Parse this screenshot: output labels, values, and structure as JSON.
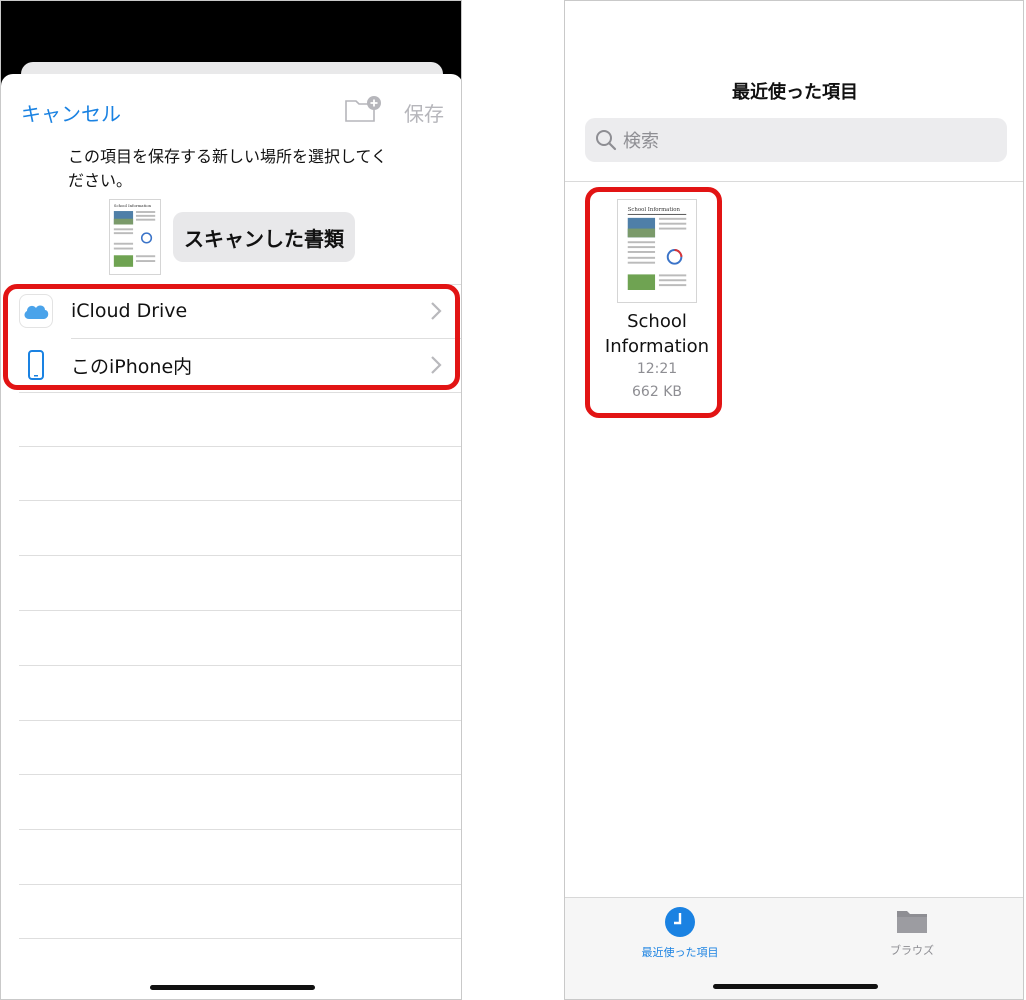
{
  "left_screen": {
    "cancel_label": "キャンセル",
    "new_folder_icon": "folder-plus-icon",
    "save_label": "保存",
    "prompt": "この項目を保存する新しい場所を選択してください。",
    "document_name": "スキャンした書類",
    "thumbnail_caption": "School Information",
    "locations": [
      {
        "label": "iCloud Drive",
        "icon": "icloud-icon"
      },
      {
        "label": "このiPhone内",
        "icon": "iphone-icon"
      }
    ],
    "colors": {
      "accent": "#1a82e2",
      "disabled": "#b6b6bb",
      "highlight": "#e21414"
    }
  },
  "right_screen": {
    "title": "最近使った項目",
    "search_placeholder": "検索",
    "file": {
      "name": "School Information",
      "time": "12:21",
      "size": "662 KB",
      "thumbnail_caption": "School Information"
    },
    "tabs": [
      {
        "label": "最近使った項目",
        "icon": "clock-icon",
        "active": true
      },
      {
        "label": "ブラウズ",
        "icon": "folder-icon",
        "active": false
      }
    ]
  }
}
